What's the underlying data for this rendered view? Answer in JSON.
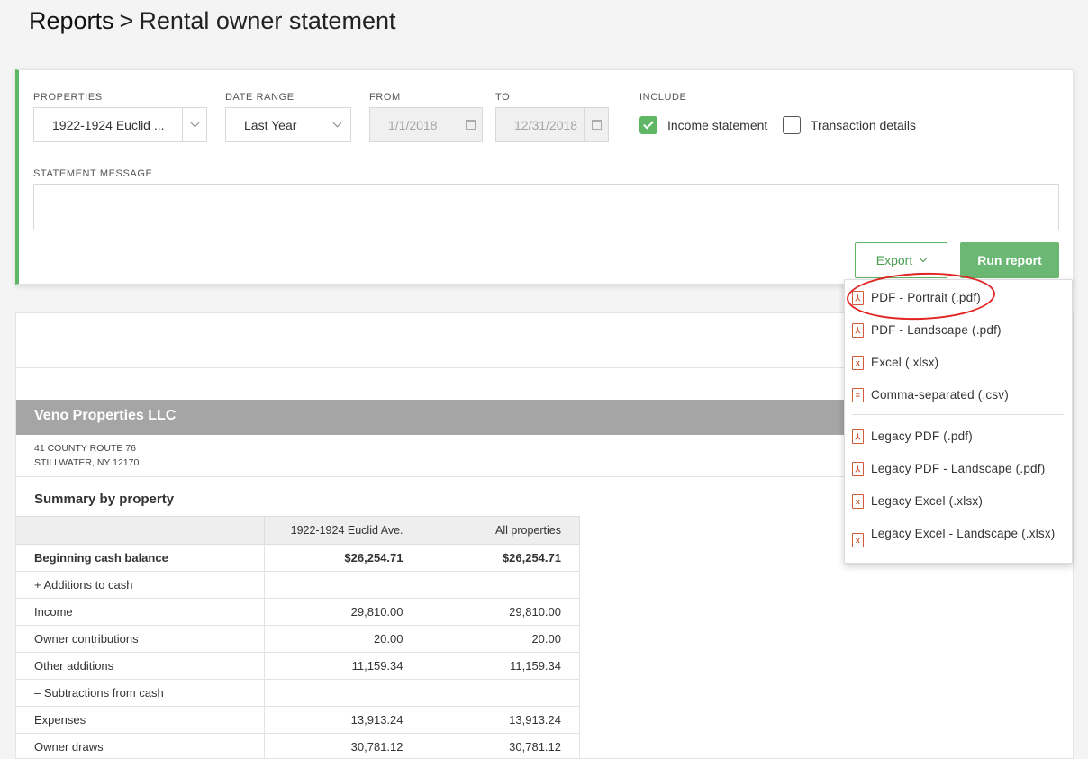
{
  "header": {
    "root": "Reports",
    "separator": ">",
    "title": "Rental owner statement"
  },
  "filters": {
    "properties": {
      "label": "PROPERTIES",
      "value": "1922-1924 Euclid ..."
    },
    "date_range": {
      "label": "DATE RANGE",
      "value": "Last Year"
    },
    "from": {
      "label": "FROM",
      "value": "1/1/2018"
    },
    "to": {
      "label": "TO",
      "value": "12/31/2018"
    },
    "include": {
      "label": "INCLUDE",
      "income_statement": {
        "label": "Income statement",
        "checked": true
      },
      "transaction_details": {
        "label": "Transaction details",
        "checked": false
      }
    },
    "statement_message": {
      "label": "STATEMENT MESSAGE",
      "value": ""
    }
  },
  "actions": {
    "export_label": "Export",
    "run_label": "Run report"
  },
  "export_menu": {
    "items": [
      {
        "label": "PDF - Portrait (.pdf)",
        "icon": "pdf-file-icon"
      },
      {
        "label": "PDF - Landscape (.pdf)",
        "icon": "pdf-file-icon"
      },
      {
        "label": "Excel (.xlsx)",
        "icon": "excel-file-icon"
      },
      {
        "label": "Comma-separated (.csv)",
        "icon": "csv-file-icon"
      },
      {
        "label": "Legacy PDF (.pdf)",
        "icon": "pdf-file-icon"
      },
      {
        "label": "Legacy PDF - Landscape (.pdf)",
        "icon": "pdf-file-icon"
      },
      {
        "label": "Legacy Excel (.xlsx)",
        "icon": "excel-file-icon"
      },
      {
        "label": "Legacy Excel - Landscape (.xlsx)",
        "icon": "excel-file-icon"
      }
    ]
  },
  "report": {
    "company": "Veno Properties LLC",
    "address_line1": "41 COUNTY ROUTE 76",
    "address_line2": "STILLWATER, NY 12170",
    "summary_title": "Summary by property",
    "columns": [
      "",
      "1922-1924 Euclid Ave.",
      "All properties"
    ],
    "rows": [
      {
        "label": "Beginning cash balance",
        "v1": "$26,254.71",
        "v2": "$26,254.71",
        "bold": true
      },
      {
        "label": "+ Additions to cash",
        "v1": "",
        "v2": "",
        "bold": false
      },
      {
        "label": "Income",
        "v1": "29,810.00",
        "v2": "29,810.00",
        "bold": false
      },
      {
        "label": "Owner contributions",
        "v1": "20.00",
        "v2": "20.00",
        "bold": false
      },
      {
        "label": "Other additions",
        "v1": "11,159.34",
        "v2": "11,159.34",
        "bold": false
      },
      {
        "label": "– Subtractions from cash",
        "v1": "",
        "v2": "",
        "bold": false
      },
      {
        "label": "Expenses",
        "v1": "13,913.24",
        "v2": "13,913.24",
        "bold": false
      },
      {
        "label": "Owner draws",
        "v1": "30,781.12",
        "v2": "30,781.12",
        "bold": false
      }
    ]
  },
  "colors": {
    "accent_green": "#5fb665",
    "annotation_red": "#e0231f",
    "file_icon": "#d05a3a"
  }
}
